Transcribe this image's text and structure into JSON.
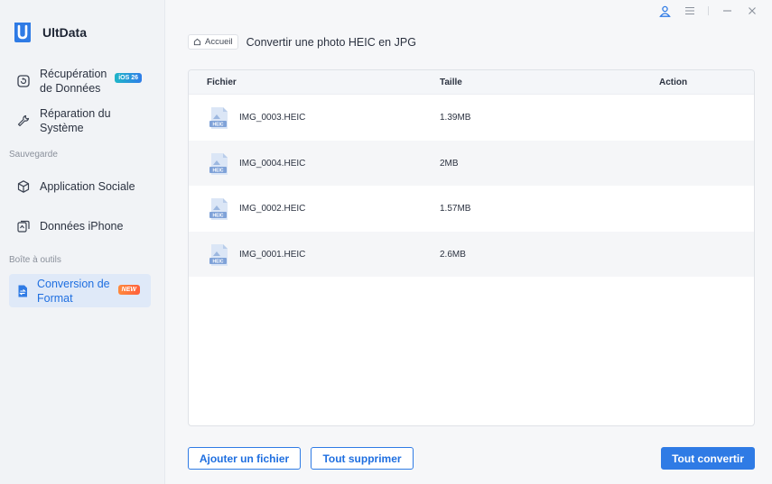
{
  "app": {
    "name": "UltData"
  },
  "sidebar": {
    "items": [
      {
        "label": "Récupération de Données",
        "badge": "iOS 26",
        "icon": "recovery-icon"
      },
      {
        "label": "Réparation du Système",
        "icon": "wrench-icon"
      },
      {
        "label": "Application Sociale",
        "icon": "cube-icon"
      },
      {
        "label": "Données iPhone",
        "icon": "phone-data-icon"
      },
      {
        "label": "Conversion de Format",
        "badge": "NEW",
        "icon": "convert-icon"
      }
    ],
    "sections": {
      "backup": "Sauvegarde",
      "toolbox": "Boîte à outils"
    }
  },
  "breadcrumb": {
    "home": "Accueil",
    "title": "Convertir une photo HEIC en JPG"
  },
  "table": {
    "headers": {
      "file": "Fichier",
      "size": "Taille",
      "action": "Action"
    },
    "rows": [
      {
        "name": "IMG_0003.HEIC",
        "size": "1.39MB",
        "icon_text": "HEIC"
      },
      {
        "name": "IMG_0004.HEIC",
        "size": "2MB",
        "icon_text": "HEIC"
      },
      {
        "name": "IMG_0002.HEIC",
        "size": "1.57MB",
        "icon_text": "HEIC"
      },
      {
        "name": "IMG_0001.HEIC",
        "size": "2.6MB",
        "icon_text": "HEIC"
      }
    ]
  },
  "buttons": {
    "add": "Ajouter un fichier",
    "clear": "Tout supprimer",
    "convert": "Tout convertir"
  },
  "colors": {
    "accent": "#2f7be5",
    "active_bg": "#dfe9f8",
    "new_badge": "#ff6a3b",
    "ios_badge": "#1fb6c8"
  }
}
